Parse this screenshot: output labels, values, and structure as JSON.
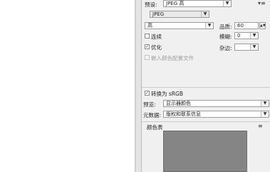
{
  "preset": {
    "label": "预设:",
    "value": "JPEG 高"
  },
  "format": {
    "value": "JPEG"
  },
  "quality_preset": {
    "value": "高"
  },
  "quality": {
    "label": "品质:",
    "value": "60"
  },
  "progressive": {
    "label": "连续",
    "checked": false
  },
  "blur": {
    "label": "模糊:",
    "value": "0"
  },
  "optimized": {
    "label": "优化",
    "checked": true
  },
  "matte": {
    "label": "杂边:"
  },
  "embed_profile": {
    "label": "嵌入颜色配置文件",
    "checked": false,
    "enabled": false
  },
  "convert_srgb": {
    "label": "转换为 sRGB",
    "checked": true
  },
  "preview": {
    "label": "预览:",
    "value": "显示器颜色"
  },
  "metadata": {
    "label": "元数据:",
    "value": "版权和联系信息"
  },
  "color_table": {
    "title": "颜色表"
  },
  "icons": {
    "panel_menu": "panel-menu-icon",
    "dropdown": "chevron-down-icon",
    "spinner": "spinner-arrows-icon"
  },
  "colors": {
    "swatch": "#858585",
    "panel_bg": "#f0f0f0"
  }
}
